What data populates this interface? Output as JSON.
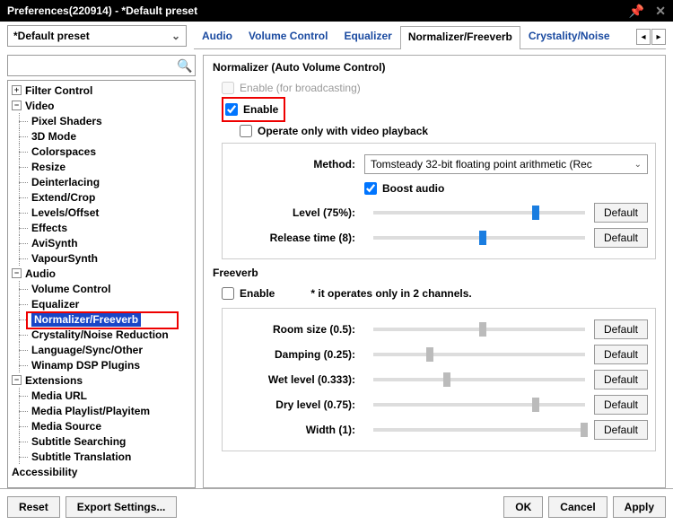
{
  "window": {
    "title": "Preferences(220914) - *Default preset"
  },
  "preset": {
    "label": "*Default preset"
  },
  "tabs": {
    "audio": "Audio",
    "volume": "Volume Control",
    "eq": "Equalizer",
    "norm": "Normalizer/Freeverb",
    "crys": "Crystality/Noise"
  },
  "search": {
    "placeholder": ""
  },
  "tree": {
    "filter": "Filter Control",
    "video": "Video",
    "video_items": [
      "Pixel Shaders",
      "3D Mode",
      "Colorspaces",
      "Resize",
      "Deinterlacing",
      "Extend/Crop",
      "Levels/Offset",
      "Effects",
      "AviSynth",
      "VapourSynth"
    ],
    "audio": "Audio",
    "audio_items": [
      "Volume Control",
      "Equalizer",
      "Normalizer/Freeverb",
      "Crystality/Noise Reduction",
      "Language/Sync/Other",
      "Winamp DSP Plugins"
    ],
    "ext": "Extensions",
    "ext_items": [
      "Media URL",
      "Media Playlist/Playitem",
      "Media Source",
      "Subtitle Searching",
      "Subtitle Translation"
    ],
    "access": "Accessibility"
  },
  "normalizer": {
    "title": "Normalizer (Auto Volume Control)",
    "enable_broadcast": "Enable (for broadcasting)",
    "enable": "Enable",
    "video_only": "Operate only with video playback",
    "method_label": "Method:",
    "method_value": "Tomsteady 32-bit floating point arithmetic (Rec",
    "boost": "Boost audio",
    "level_label": "Level (75%):",
    "release_label": "Release time (8):"
  },
  "freeverb": {
    "title": "Freeverb",
    "enable": "Enable",
    "note": "* it operates only in 2 channels.",
    "room": "Room size (0.5):",
    "damp": "Damping (0.25):",
    "wet": "Wet level (0.333):",
    "dry": "Dry level (0.75):",
    "width": "Width (1):"
  },
  "buttons": {
    "default": "Default",
    "reset": "Reset",
    "export": "Export Settings...",
    "ok": "OK",
    "cancel": "Cancel",
    "apply": "Apply"
  }
}
